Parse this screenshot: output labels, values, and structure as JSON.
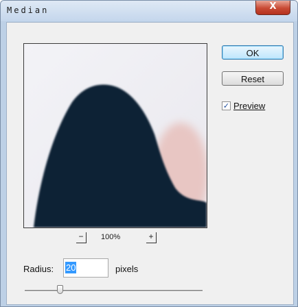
{
  "window": {
    "title": "Median",
    "close_glyph": "X",
    "close_icon": "close-icon"
  },
  "preview_pane": {
    "image_description": "blurred dark navy shape on light background",
    "zoom_out_glyph": "−",
    "zoom_in_glyph": "+",
    "zoom_level": "100%"
  },
  "buttons": {
    "ok_label": "OK",
    "reset_label": "Reset"
  },
  "preview_option": {
    "checked": true,
    "check_glyph": "✓",
    "label": "Preview"
  },
  "radius": {
    "label": "Radius:",
    "value": "20",
    "units": "pixels",
    "slider_fraction": 0.2
  },
  "colors": {
    "titlebar": "#c4d6ec",
    "close_button": "#c84a34",
    "dialog_background": "#f0f0f0",
    "selection": "#3399ff",
    "shape": "#0c2235"
  }
}
